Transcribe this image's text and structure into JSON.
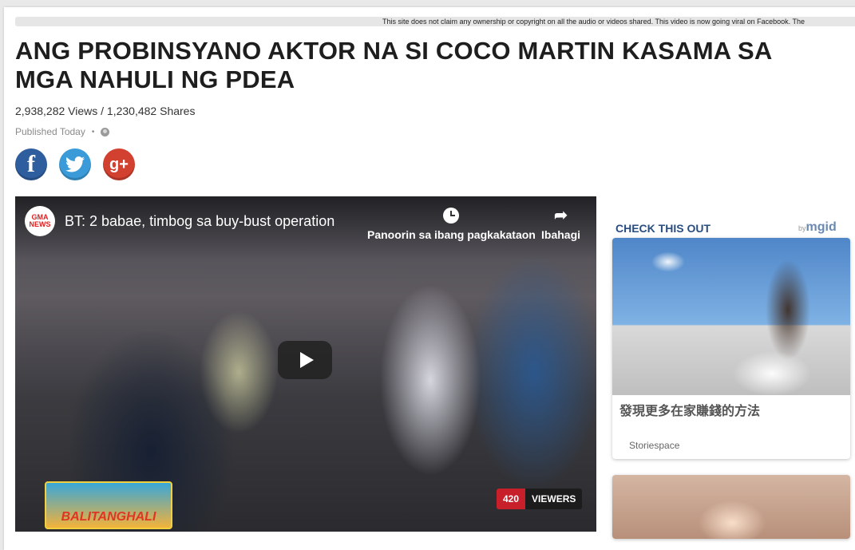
{
  "disclaimer": "This site does not claim any ownership or copyright on all the audio or videos shared. This video is now going viral on Facebook. The",
  "article": {
    "headline": "ANG PROBINSYANO AKTOR NA SI COCO MARTIN KASAMA SA MGA NAHULI NG PDEA",
    "stats": "2,938,282 Views / 1,230,482 Shares",
    "published": "Published Today",
    "separator": "•"
  },
  "social": {
    "facebook": "f",
    "google_plus": "g+"
  },
  "video": {
    "channel": "GMA NEWS",
    "title": "BT: 2 babae, timbog sa buy-bust operation",
    "watch_later": "Panoorin sa ibang pagkakataon",
    "share": "Ibahagi",
    "show_logo": "BALITANGHALI",
    "viewers_count": "420",
    "viewers_label": "VIEWERS"
  },
  "sidebar": {
    "heading": "CHECK THIS OUT",
    "provider_prefix": "by",
    "provider": "mgid",
    "card": {
      "title": "發現更多在家賺錢的方法",
      "source": "Storiespace"
    }
  },
  "colors": {
    "facebook": "#2f5e9e",
    "twitter": "#3b9bd8",
    "google_plus": "#d2402f",
    "viewers_badge": "#c8202a",
    "sidebar_heading": "#2a4d80"
  }
}
